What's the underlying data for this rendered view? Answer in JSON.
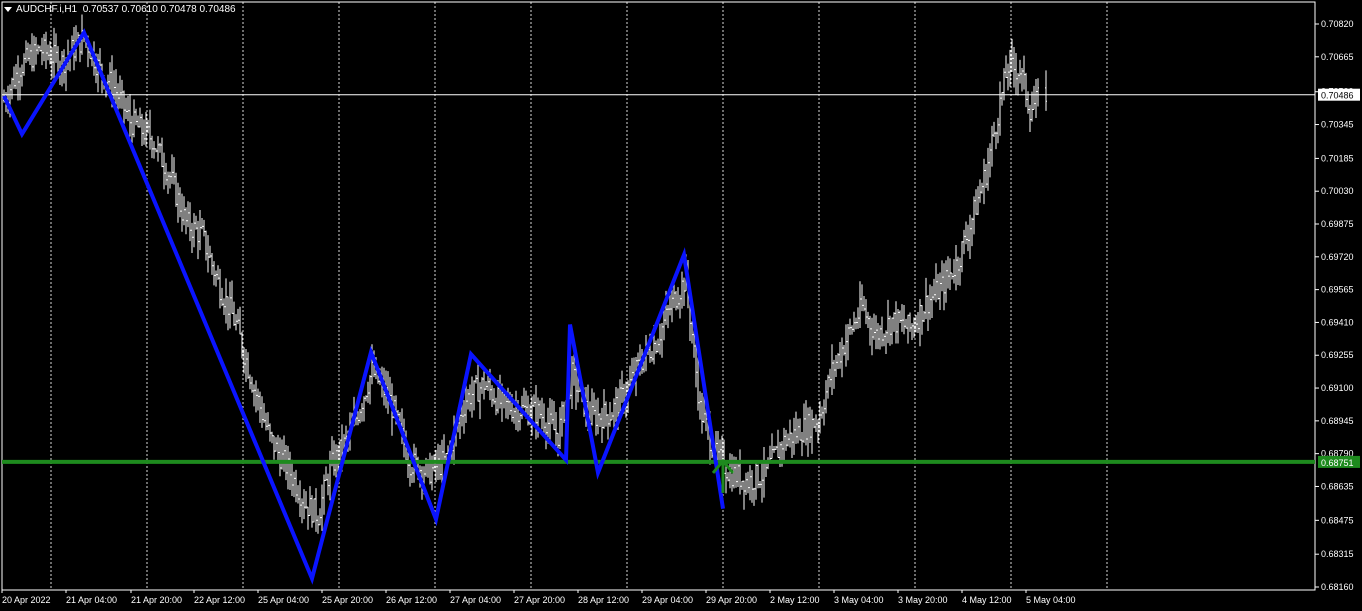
{
  "window": {
    "symbol": "AUDCHF.i,H1",
    "ohlc": "0.70537 0.70610 0.70478 0.70486"
  },
  "price_axis": {
    "ticks": [
      "0.70820",
      "0.70665",
      "0.70500",
      "0.70345",
      "0.70185",
      "0.70030",
      "0.69875",
      "0.69720",
      "0.69565",
      "0.69410",
      "0.69255",
      "0.69100",
      "0.68945",
      "0.68790",
      "0.68635",
      "0.68475",
      "0.68315",
      "0.68160"
    ],
    "current_price_label": "0.70486",
    "support_label": "0.68751"
  },
  "time_axis": {
    "labels": [
      "20 Apr 2022",
      "21 Apr 04:00",
      "21 Apr 20:00",
      "22 Apr 12:00",
      "25 Apr 04:00",
      "25 Apr 20:00",
      "26 Apr 12:00",
      "27 Apr 04:00",
      "27 Apr 20:00",
      "28 Apr 12:00",
      "29 Apr 04:00",
      "29 Apr 20:00",
      "2 May 12:00",
      "3 May 04:00",
      "3 May 20:00",
      "4 May 12:00",
      "5 May 04:00"
    ]
  },
  "colors": {
    "background": "#000000",
    "bars": "#ffffff",
    "zigzag": "#0a14ff",
    "support": "#1e8a1e",
    "arrow": "#1e8a1e",
    "grid": "#ffffff",
    "text": "#ffffff"
  },
  "chart_data": {
    "type": "line",
    "title": "AUDCHF.i,H1",
    "ylim": [
      0.6816,
      0.7082
    ],
    "current_price": 0.70486,
    "support_level": 0.68751,
    "zigzag": {
      "x": [
        "20 Apr 2022",
        "20 Apr 2022 (late)",
        "21 Apr 04:00",
        "25 Apr 04:00",
        "25 Apr 20:00",
        "26 Apr 12:00",
        "26 Apr 20:00",
        "27 Apr 20:00",
        "28 Apr 04:00",
        "28 Apr 08:00",
        "29 Apr 04:00",
        "29 Apr 20:00"
      ],
      "y": [
        0.7048,
        0.703,
        0.7078,
        0.682,
        0.6927,
        0.6848,
        0.6926,
        0.6876,
        0.694,
        0.687,
        0.6973,
        0.6853
      ]
    },
    "gridlines": "vertical dashed",
    "arrow_marker": "up, at 29 Apr 20:00 near support"
  }
}
